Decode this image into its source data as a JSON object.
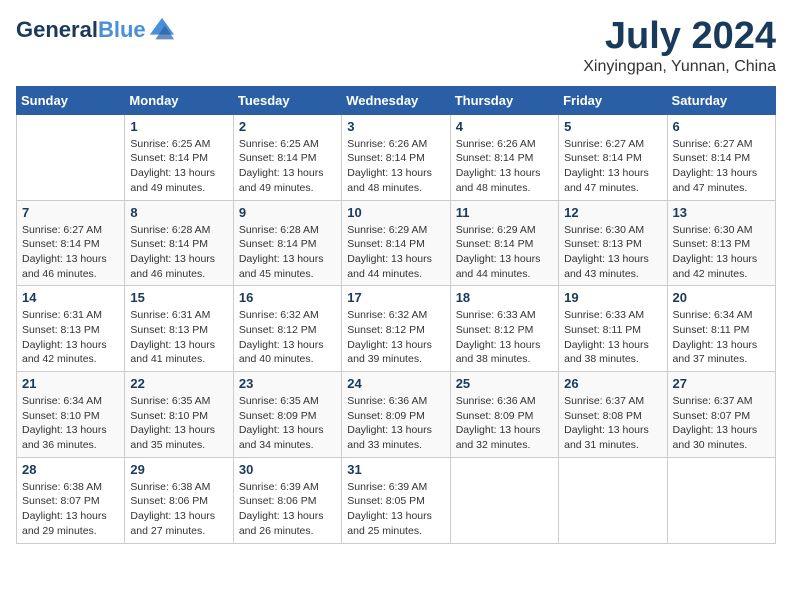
{
  "header": {
    "logo_line1": "General",
    "logo_line2": "Blue",
    "month_title": "July 2024",
    "location": "Xinyingpan, Yunnan, China"
  },
  "weekdays": [
    "Sunday",
    "Monday",
    "Tuesday",
    "Wednesday",
    "Thursday",
    "Friday",
    "Saturday"
  ],
  "weeks": [
    [
      {
        "day": "",
        "sunrise": "",
        "sunset": "",
        "daylight": ""
      },
      {
        "day": "1",
        "sunrise": "Sunrise: 6:25 AM",
        "sunset": "Sunset: 8:14 PM",
        "daylight": "Daylight: 13 hours and 49 minutes."
      },
      {
        "day": "2",
        "sunrise": "Sunrise: 6:25 AM",
        "sunset": "Sunset: 8:14 PM",
        "daylight": "Daylight: 13 hours and 49 minutes."
      },
      {
        "day": "3",
        "sunrise": "Sunrise: 6:26 AM",
        "sunset": "Sunset: 8:14 PM",
        "daylight": "Daylight: 13 hours and 48 minutes."
      },
      {
        "day": "4",
        "sunrise": "Sunrise: 6:26 AM",
        "sunset": "Sunset: 8:14 PM",
        "daylight": "Daylight: 13 hours and 48 minutes."
      },
      {
        "day": "5",
        "sunrise": "Sunrise: 6:27 AM",
        "sunset": "Sunset: 8:14 PM",
        "daylight": "Daylight: 13 hours and 47 minutes."
      },
      {
        "day": "6",
        "sunrise": "Sunrise: 6:27 AM",
        "sunset": "Sunset: 8:14 PM",
        "daylight": "Daylight: 13 hours and 47 minutes."
      }
    ],
    [
      {
        "day": "7",
        "sunrise": "Sunrise: 6:27 AM",
        "sunset": "Sunset: 8:14 PM",
        "daylight": "Daylight: 13 hours and 46 minutes."
      },
      {
        "day": "8",
        "sunrise": "Sunrise: 6:28 AM",
        "sunset": "Sunset: 8:14 PM",
        "daylight": "Daylight: 13 hours and 46 minutes."
      },
      {
        "day": "9",
        "sunrise": "Sunrise: 6:28 AM",
        "sunset": "Sunset: 8:14 PM",
        "daylight": "Daylight: 13 hours and 45 minutes."
      },
      {
        "day": "10",
        "sunrise": "Sunrise: 6:29 AM",
        "sunset": "Sunset: 8:14 PM",
        "daylight": "Daylight: 13 hours and 44 minutes."
      },
      {
        "day": "11",
        "sunrise": "Sunrise: 6:29 AM",
        "sunset": "Sunset: 8:14 PM",
        "daylight": "Daylight: 13 hours and 44 minutes."
      },
      {
        "day": "12",
        "sunrise": "Sunrise: 6:30 AM",
        "sunset": "Sunset: 8:13 PM",
        "daylight": "Daylight: 13 hours and 43 minutes."
      },
      {
        "day": "13",
        "sunrise": "Sunrise: 6:30 AM",
        "sunset": "Sunset: 8:13 PM",
        "daylight": "Daylight: 13 hours and 42 minutes."
      }
    ],
    [
      {
        "day": "14",
        "sunrise": "Sunrise: 6:31 AM",
        "sunset": "Sunset: 8:13 PM",
        "daylight": "Daylight: 13 hours and 42 minutes."
      },
      {
        "day": "15",
        "sunrise": "Sunrise: 6:31 AM",
        "sunset": "Sunset: 8:13 PM",
        "daylight": "Daylight: 13 hours and 41 minutes."
      },
      {
        "day": "16",
        "sunrise": "Sunrise: 6:32 AM",
        "sunset": "Sunset: 8:12 PM",
        "daylight": "Daylight: 13 hours and 40 minutes."
      },
      {
        "day": "17",
        "sunrise": "Sunrise: 6:32 AM",
        "sunset": "Sunset: 8:12 PM",
        "daylight": "Daylight: 13 hours and 39 minutes."
      },
      {
        "day": "18",
        "sunrise": "Sunrise: 6:33 AM",
        "sunset": "Sunset: 8:12 PM",
        "daylight": "Daylight: 13 hours and 38 minutes."
      },
      {
        "day": "19",
        "sunrise": "Sunrise: 6:33 AM",
        "sunset": "Sunset: 8:11 PM",
        "daylight": "Daylight: 13 hours and 38 minutes."
      },
      {
        "day": "20",
        "sunrise": "Sunrise: 6:34 AM",
        "sunset": "Sunset: 8:11 PM",
        "daylight": "Daylight: 13 hours and 37 minutes."
      }
    ],
    [
      {
        "day": "21",
        "sunrise": "Sunrise: 6:34 AM",
        "sunset": "Sunset: 8:10 PM",
        "daylight": "Daylight: 13 hours and 36 minutes."
      },
      {
        "day": "22",
        "sunrise": "Sunrise: 6:35 AM",
        "sunset": "Sunset: 8:10 PM",
        "daylight": "Daylight: 13 hours and 35 minutes."
      },
      {
        "day": "23",
        "sunrise": "Sunrise: 6:35 AM",
        "sunset": "Sunset: 8:09 PM",
        "daylight": "Daylight: 13 hours and 34 minutes."
      },
      {
        "day": "24",
        "sunrise": "Sunrise: 6:36 AM",
        "sunset": "Sunset: 8:09 PM",
        "daylight": "Daylight: 13 hours and 33 minutes."
      },
      {
        "day": "25",
        "sunrise": "Sunrise: 6:36 AM",
        "sunset": "Sunset: 8:09 PM",
        "daylight": "Daylight: 13 hours and 32 minutes."
      },
      {
        "day": "26",
        "sunrise": "Sunrise: 6:37 AM",
        "sunset": "Sunset: 8:08 PM",
        "daylight": "Daylight: 13 hours and 31 minutes."
      },
      {
        "day": "27",
        "sunrise": "Sunrise: 6:37 AM",
        "sunset": "Sunset: 8:07 PM",
        "daylight": "Daylight: 13 hours and 30 minutes."
      }
    ],
    [
      {
        "day": "28",
        "sunrise": "Sunrise: 6:38 AM",
        "sunset": "Sunset: 8:07 PM",
        "daylight": "Daylight: 13 hours and 29 minutes."
      },
      {
        "day": "29",
        "sunrise": "Sunrise: 6:38 AM",
        "sunset": "Sunset: 8:06 PM",
        "daylight": "Daylight: 13 hours and 27 minutes."
      },
      {
        "day": "30",
        "sunrise": "Sunrise: 6:39 AM",
        "sunset": "Sunset: 8:06 PM",
        "daylight": "Daylight: 13 hours and 26 minutes."
      },
      {
        "day": "31",
        "sunrise": "Sunrise: 6:39 AM",
        "sunset": "Sunset: 8:05 PM",
        "daylight": "Daylight: 13 hours and 25 minutes."
      },
      {
        "day": "",
        "sunrise": "",
        "sunset": "",
        "daylight": ""
      },
      {
        "day": "",
        "sunrise": "",
        "sunset": "",
        "daylight": ""
      },
      {
        "day": "",
        "sunrise": "",
        "sunset": "",
        "daylight": ""
      }
    ]
  ]
}
